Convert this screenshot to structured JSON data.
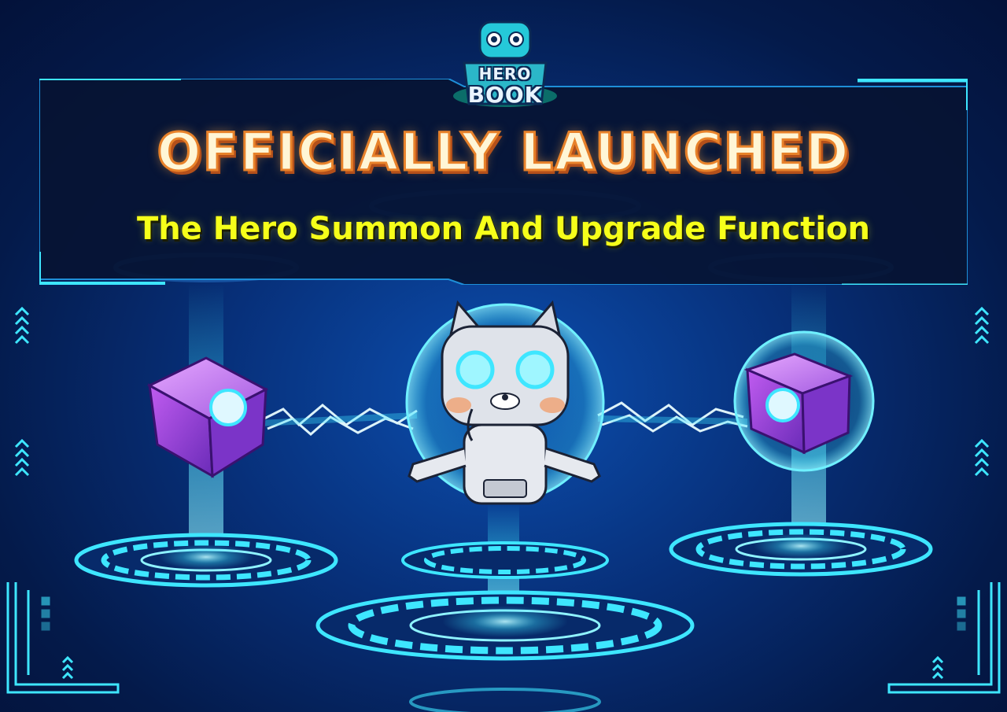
{
  "logo": {
    "line1": "HERO",
    "line2": "BOOK"
  },
  "banner": {
    "headline": "OFFICIALLY LAUNCHED",
    "subheadline": "The Hero Summon And Upgrade Function"
  },
  "colors": {
    "background": "#063a8c",
    "banner_fill": "#061433",
    "neon_cyan": "#3ee6ff",
    "headline_orange": "#e8822a",
    "subhead_yellow": "#f6ff1a",
    "cube_purple": "#8a3fd6"
  },
  "icons": [
    "hero-book-logo",
    "summon-cube-left",
    "summon-cube-right",
    "hero-robot-cat",
    "chevron-up-icon",
    "summon-platform",
    "lightning-beam"
  ]
}
